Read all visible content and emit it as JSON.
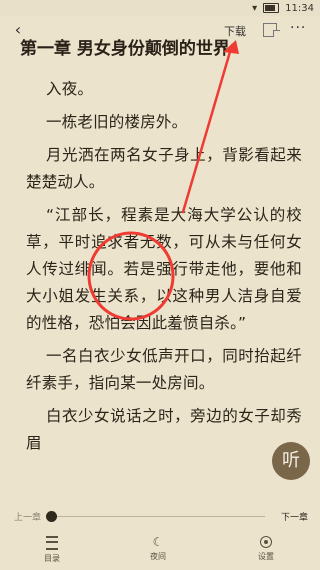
{
  "status": {
    "time": "11:34"
  },
  "toolbar": {
    "download_label": "下载"
  },
  "chapter": {
    "title": "第一章 男女身份颠倒的世界"
  },
  "content": {
    "paragraphs": [
      "入夜。",
      "一栋老旧的楼房外。",
      "月光洒在两名女子身上，背影看起来楚楚动人。",
      "“江部长，程素是大海大学公认的校草，平时追求者无数，可从未与任何女人传过绯闻。若是强行带走他，要他和大小姐发生关系，以这种男人洁身自爱的性格，恐怕会因此羞愤自杀。”",
      "一名白衣少女低声开口，同时抬起纤纤素手，指向某一处房间。",
      "白衣少女说话之时，旁边的女子却秀眉"
    ]
  },
  "chapter_nav": {
    "prev_label": "上一章",
    "next_label": "下一章",
    "progress": 0
  },
  "bottom_tabs": {
    "catalog": "目录",
    "night": "夜间",
    "settings": "设置"
  },
  "listen": {
    "label": "听"
  },
  "annotation": {
    "color": "#ee3b33"
  }
}
